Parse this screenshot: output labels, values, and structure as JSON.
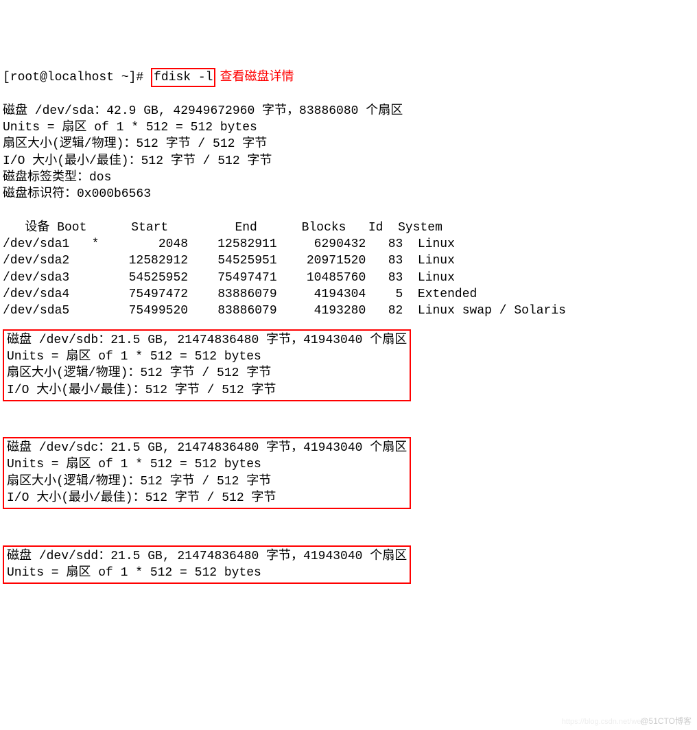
{
  "prompt_prefix": "[root@localhost ~]# ",
  "command": "fdisk -l",
  "annotation": "查看磁盘详情",
  "disk_a": {
    "header": "磁盘 /dev/sda：42.9 GB, 42949672960 字节，83886080 个扇区",
    "units": "Units = 扇区 of 1 * 512 = 512 bytes",
    "sector": "扇区大小(逻辑/物理)：512 字节 / 512 字节",
    "io": "I/O 大小(最小/最佳)：512 字节 / 512 字节",
    "label": "磁盘标签类型：dos",
    "ident": "磁盘标识符：0x000b6563"
  },
  "partitions": {
    "header": "   设备 Boot      Start         End      Blocks   Id  System",
    "rows": [
      "/dev/sda1   *        2048    12582911     6290432   83  Linux",
      "/dev/sda2        12582912    54525951    20971520   83  Linux",
      "/dev/sda3        54525952    75497471    10485760   83  Linux",
      "/dev/sda4        75497472    83886079     4194304    5  Extended",
      "/dev/sda5        75499520    83886079     4193280   82  Linux swap / Solaris"
    ]
  },
  "disk_b": {
    "header": "磁盘 /dev/sdb：21.5 GB, 21474836480 字节，41943040 个扇区",
    "units": "Units = 扇区 of 1 * 512 = 512 bytes",
    "sector": "扇区大小(逻辑/物理)：512 字节 / 512 字节",
    "io": "I/O 大小(最小/最佳)：512 字节 / 512 字节"
  },
  "disk_c": {
    "header": "磁盘 /dev/sdc：21.5 GB, 21474836480 字节，41943040 个扇区",
    "units": "Units = 扇区 of 1 * 512 = 512 bytes",
    "sector": "扇区大小(逻辑/物理)：512 字节 / 512 字节",
    "io": "I/O 大小(最小/最佳)：512 字节 / 512 字节"
  },
  "disk_d": {
    "header": "磁盘 /dev/sdd：21.5 GB, 21474836480 字节，41943040 个扇区",
    "units": "Units = 扇区 of 1 * 512 = 512 bytes"
  },
  "watermark": "@51CTO博客",
  "watermark2": "https://blog.csdn.net/wei..."
}
